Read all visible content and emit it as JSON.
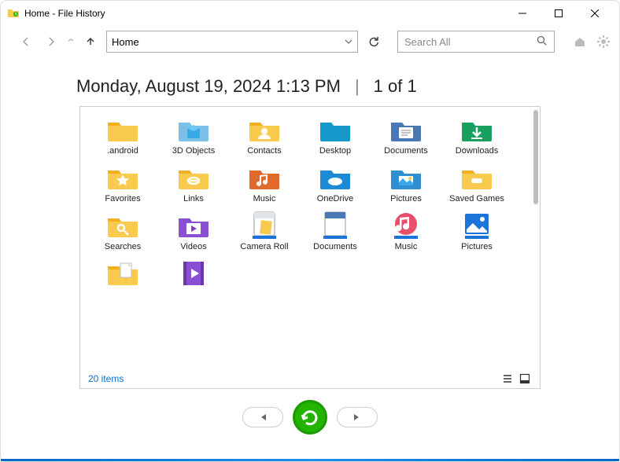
{
  "window": {
    "title": "Home - File History",
    "controls": {
      "min": "minimize",
      "max": "maximize",
      "close": "close"
    }
  },
  "toolbar": {
    "location": "Home",
    "search_placeholder": "Search All"
  },
  "header": {
    "date": "Monday, August 19, 2024 1:13 PM",
    "position": "1 of 1"
  },
  "items": [
    {
      "label": ".android",
      "icon": "folder"
    },
    {
      "label": "3D Objects",
      "icon": "folder-3d"
    },
    {
      "label": "Contacts",
      "icon": "folder-contacts"
    },
    {
      "label": "Desktop",
      "icon": "folder-desktop"
    },
    {
      "label": "Documents",
      "icon": "folder-documents"
    },
    {
      "label": "Downloads",
      "icon": "folder-downloads"
    },
    {
      "label": "Favorites",
      "icon": "folder-favorites"
    },
    {
      "label": "Links",
      "icon": "folder-links"
    },
    {
      "label": "Music",
      "icon": "folder-music"
    },
    {
      "label": "OneDrive",
      "icon": "folder-onedrive"
    },
    {
      "label": "Pictures",
      "icon": "folder-pictures"
    },
    {
      "label": "Saved Games",
      "icon": "folder-games"
    },
    {
      "label": "Searches",
      "icon": "folder-searches"
    },
    {
      "label": "Videos",
      "icon": "folder-videos"
    },
    {
      "label": "Camera Roll",
      "icon": "library-camera"
    },
    {
      "label": "Documents",
      "icon": "library-documents"
    },
    {
      "label": "Music",
      "icon": "library-music"
    },
    {
      "label": "Pictures",
      "icon": "library-pictures"
    },
    {
      "label": "",
      "icon": "folder-with-file"
    },
    {
      "label": "",
      "icon": "folder-video-file"
    }
  ],
  "footer": {
    "count_text": "20 items"
  },
  "colors": {
    "accent": "#22b400",
    "link": "#0b6dd7",
    "folder_yellow": "#f8ca4d",
    "library_blue": "#1c74d8"
  }
}
